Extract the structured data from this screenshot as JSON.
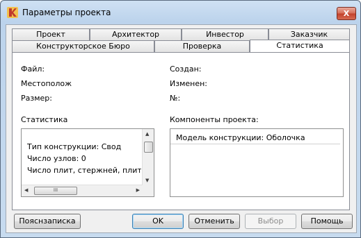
{
  "window": {
    "title": "Параметры проекта",
    "close_glyph": "X"
  },
  "tabs_row1": [
    "Проект",
    "Архитектор",
    "Инвестор",
    "Заказчик"
  ],
  "tabs_row2": [
    "Конструкторское Бюро",
    "Проверка",
    "Статистика"
  ],
  "active_tab": "Статистика",
  "fields": {
    "file_label": "Файл:",
    "location_label": "Местополож",
    "size_label": "Размер:",
    "created_label": "Создан:",
    "modified_label": "Изменен:",
    "number_label": "№:"
  },
  "statistics": {
    "label": "Статистика",
    "lines": [
      "Тип конструкции: Свод",
      "Число узлов: 0",
      "Число плит, стержней, плит и об"
    ]
  },
  "components": {
    "label": "Компоненты проекта:",
    "items": [
      "Модель конструкции: Оболочка"
    ]
  },
  "buttons": {
    "note": "Пояснзаписка",
    "ok": "OK",
    "cancel": "Отменить",
    "select": "Выбор",
    "help": "Помощь"
  },
  "scroll_glyphs": {
    "up": "▲",
    "down": "▼",
    "left": "◀",
    "right": "▶",
    "grip": "III"
  }
}
